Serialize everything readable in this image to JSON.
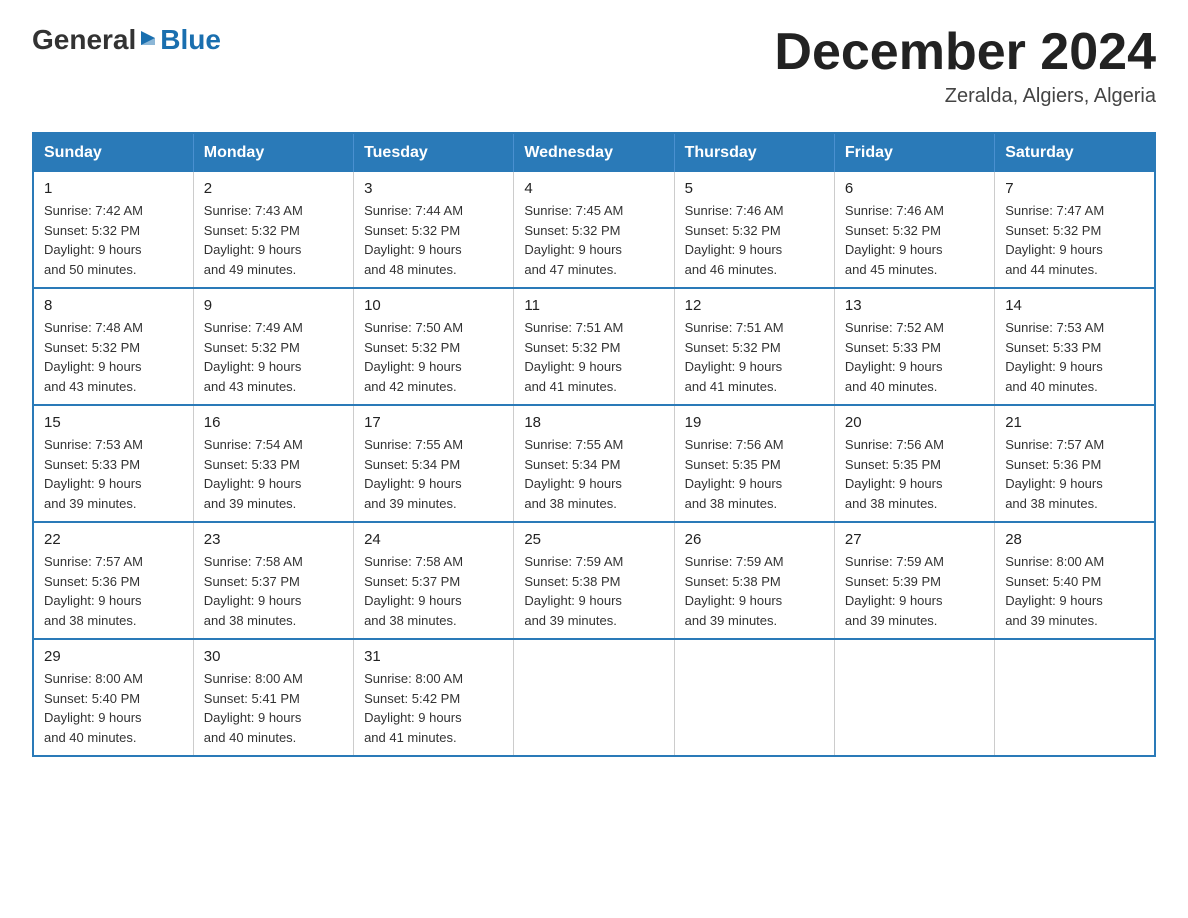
{
  "header": {
    "logo_general": "General",
    "logo_blue": "Blue",
    "month_title": "December 2024",
    "location": "Zeralda, Algiers, Algeria"
  },
  "days_of_week": [
    "Sunday",
    "Monday",
    "Tuesday",
    "Wednesday",
    "Thursday",
    "Friday",
    "Saturday"
  ],
  "weeks": [
    [
      {
        "day": "1",
        "sunrise": "7:42 AM",
        "sunset": "5:32 PM",
        "daylight": "9 hours and 50 minutes."
      },
      {
        "day": "2",
        "sunrise": "7:43 AM",
        "sunset": "5:32 PM",
        "daylight": "9 hours and 49 minutes."
      },
      {
        "day": "3",
        "sunrise": "7:44 AM",
        "sunset": "5:32 PM",
        "daylight": "9 hours and 48 minutes."
      },
      {
        "day": "4",
        "sunrise": "7:45 AM",
        "sunset": "5:32 PM",
        "daylight": "9 hours and 47 minutes."
      },
      {
        "day": "5",
        "sunrise": "7:46 AM",
        "sunset": "5:32 PM",
        "daylight": "9 hours and 46 minutes."
      },
      {
        "day": "6",
        "sunrise": "7:46 AM",
        "sunset": "5:32 PM",
        "daylight": "9 hours and 45 minutes."
      },
      {
        "day": "7",
        "sunrise": "7:47 AM",
        "sunset": "5:32 PM",
        "daylight": "9 hours and 44 minutes."
      }
    ],
    [
      {
        "day": "8",
        "sunrise": "7:48 AM",
        "sunset": "5:32 PM",
        "daylight": "9 hours and 43 minutes."
      },
      {
        "day": "9",
        "sunrise": "7:49 AM",
        "sunset": "5:32 PM",
        "daylight": "9 hours and 43 minutes."
      },
      {
        "day": "10",
        "sunrise": "7:50 AM",
        "sunset": "5:32 PM",
        "daylight": "9 hours and 42 minutes."
      },
      {
        "day": "11",
        "sunrise": "7:51 AM",
        "sunset": "5:32 PM",
        "daylight": "9 hours and 41 minutes."
      },
      {
        "day": "12",
        "sunrise": "7:51 AM",
        "sunset": "5:32 PM",
        "daylight": "9 hours and 41 minutes."
      },
      {
        "day": "13",
        "sunrise": "7:52 AM",
        "sunset": "5:33 PM",
        "daylight": "9 hours and 40 minutes."
      },
      {
        "day": "14",
        "sunrise": "7:53 AM",
        "sunset": "5:33 PM",
        "daylight": "9 hours and 40 minutes."
      }
    ],
    [
      {
        "day": "15",
        "sunrise": "7:53 AM",
        "sunset": "5:33 PM",
        "daylight": "9 hours and 39 minutes."
      },
      {
        "day": "16",
        "sunrise": "7:54 AM",
        "sunset": "5:33 PM",
        "daylight": "9 hours and 39 minutes."
      },
      {
        "day": "17",
        "sunrise": "7:55 AM",
        "sunset": "5:34 PM",
        "daylight": "9 hours and 39 minutes."
      },
      {
        "day": "18",
        "sunrise": "7:55 AM",
        "sunset": "5:34 PM",
        "daylight": "9 hours and 38 minutes."
      },
      {
        "day": "19",
        "sunrise": "7:56 AM",
        "sunset": "5:35 PM",
        "daylight": "9 hours and 38 minutes."
      },
      {
        "day": "20",
        "sunrise": "7:56 AM",
        "sunset": "5:35 PM",
        "daylight": "9 hours and 38 minutes."
      },
      {
        "day": "21",
        "sunrise": "7:57 AM",
        "sunset": "5:36 PM",
        "daylight": "9 hours and 38 minutes."
      }
    ],
    [
      {
        "day": "22",
        "sunrise": "7:57 AM",
        "sunset": "5:36 PM",
        "daylight": "9 hours and 38 minutes."
      },
      {
        "day": "23",
        "sunrise": "7:58 AM",
        "sunset": "5:37 PM",
        "daylight": "9 hours and 38 minutes."
      },
      {
        "day": "24",
        "sunrise": "7:58 AM",
        "sunset": "5:37 PM",
        "daylight": "9 hours and 38 minutes."
      },
      {
        "day": "25",
        "sunrise": "7:59 AM",
        "sunset": "5:38 PM",
        "daylight": "9 hours and 39 minutes."
      },
      {
        "day": "26",
        "sunrise": "7:59 AM",
        "sunset": "5:38 PM",
        "daylight": "9 hours and 39 minutes."
      },
      {
        "day": "27",
        "sunrise": "7:59 AM",
        "sunset": "5:39 PM",
        "daylight": "9 hours and 39 minutes."
      },
      {
        "day": "28",
        "sunrise": "8:00 AM",
        "sunset": "5:40 PM",
        "daylight": "9 hours and 39 minutes."
      }
    ],
    [
      {
        "day": "29",
        "sunrise": "8:00 AM",
        "sunset": "5:40 PM",
        "daylight": "9 hours and 40 minutes."
      },
      {
        "day": "30",
        "sunrise": "8:00 AM",
        "sunset": "5:41 PM",
        "daylight": "9 hours and 40 minutes."
      },
      {
        "day": "31",
        "sunrise": "8:00 AM",
        "sunset": "5:42 PM",
        "daylight": "9 hours and 41 minutes."
      },
      null,
      null,
      null,
      null
    ]
  ],
  "labels": {
    "sunrise": "Sunrise:",
    "sunset": "Sunset:",
    "daylight": "Daylight:"
  },
  "colors": {
    "header_bg": "#2a7ab8",
    "header_text": "#ffffff",
    "border": "#2a7ab8",
    "body_text": "#333333",
    "title_text": "#222222"
  }
}
